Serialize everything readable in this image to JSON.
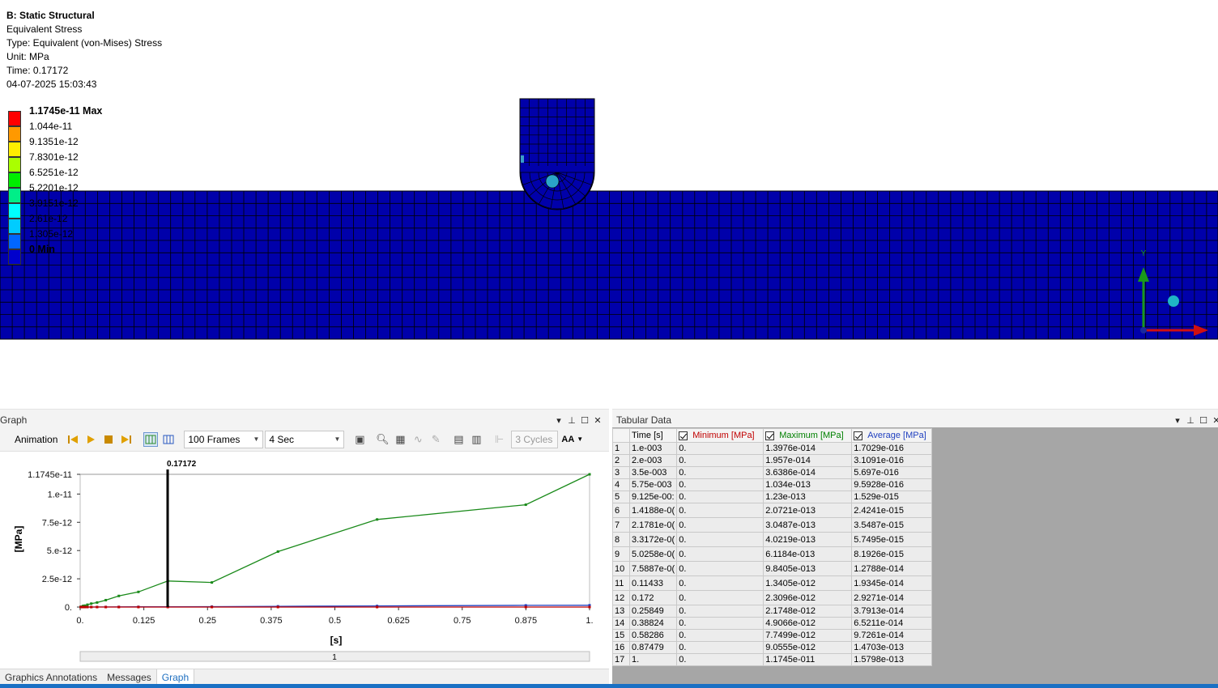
{
  "viewport": {
    "info": {
      "system": "B: Static Structural",
      "result": "Equivalent Stress",
      "type": "Type: Equivalent (von-Mises) Stress",
      "unit": "Unit: MPa",
      "time": "Time: 0.17172",
      "date": "04-07-2025 15:03:43"
    },
    "legend": {
      "max_label": "1.1745e-11 Max",
      "levels": [
        "1.044e-11",
        "9.1351e-12",
        "7.8301e-12",
        "6.5251e-12",
        "5.2201e-12",
        "3.9151e-12",
        "2.61e-12",
        "1.305e-12"
      ],
      "min_label": "0 Min",
      "colors": [
        "#ff0000",
        "#ff9900",
        "#ffee00",
        "#aaff00",
        "#00ee00",
        "#00ee88",
        "#00ffff",
        "#00ccff",
        "#0066ff",
        "#0000cc"
      ]
    },
    "triad": {
      "y_label": "Y"
    },
    "mesh_color": "#0000aa"
  },
  "graph_panel": {
    "title": "Graph",
    "toolbar": {
      "animation_label": "Animation",
      "frames_value": "100 Frames",
      "duration_value": "4 Sec",
      "cycles_placeholder": "3 Cycles",
      "font_button": "AA"
    },
    "tabs": [
      "Graphics Annotations",
      "Messages",
      "Graph"
    ],
    "active_tab": "Graph",
    "timeline_value": "1"
  },
  "tabular_panel": {
    "title": "Tabular Data",
    "columns": [
      "Time [s]",
      "Minimum [MPa]",
      "Maximum [MPa]",
      "Average [MPa]"
    ],
    "column_colors": [
      "#000000",
      "#c00000",
      "#008000",
      "#1f3fbf"
    ],
    "rows": [
      [
        "1",
        "1.e-003",
        "0.",
        "1.3976e-014",
        "1.7029e-016"
      ],
      [
        "2",
        "2.e-003",
        "0.",
        "1.957e-014",
        "3.1091e-016"
      ],
      [
        "3",
        "3.5e-003",
        "0.",
        "3.6386e-014",
        "5.697e-016"
      ],
      [
        "4",
        "5.75e-003",
        "0.",
        "1.034e-013",
        "9.5928e-016"
      ],
      [
        "5",
        "9.125e-00:",
        "0.",
        "1.23e-013",
        "1.529e-015"
      ],
      [
        "6",
        "1.4188e-0(",
        "0.",
        "2.0721e-013",
        "2.4241e-015"
      ],
      [
        "7",
        "2.1781e-0(",
        "0.",
        "3.0487e-013",
        "3.5487e-015"
      ],
      [
        "8",
        "3.3172e-0(",
        "0.",
        "4.0219e-013",
        "5.7495e-015"
      ],
      [
        "9",
        "5.0258e-0(",
        "0.",
        "6.1184e-013",
        "8.1926e-015"
      ],
      [
        "10",
        "7.5887e-0(",
        "0.",
        "9.8405e-013",
        "1.2788e-014"
      ],
      [
        "11",
        "0.11433",
        "0.",
        "1.3405e-012",
        "1.9345e-014"
      ],
      [
        "12",
        "0.172",
        "0.",
        "2.3096e-012",
        "2.9271e-014"
      ],
      [
        "13",
        "0.25849",
        "0.",
        "2.1748e-012",
        "3.7913e-014"
      ],
      [
        "14",
        "0.38824",
        "0.",
        "4.9066e-012",
        "6.5211e-014"
      ],
      [
        "15",
        "0.58286",
        "0.",
        "7.7499e-012",
        "9.7261e-014"
      ],
      [
        "16",
        "0.87479",
        "0.",
        "9.0555e-012",
        "1.4703e-013"
      ],
      [
        "17",
        "1.",
        "0.",
        "1.1745e-011",
        "1.5798e-013"
      ]
    ]
  },
  "chart_data": {
    "type": "line",
    "title": "",
    "xlabel": "[s]",
    "ylabel": "[MPa]",
    "xlim": [
      0,
      1
    ],
    "ylim": [
      0,
      1.1745e-11
    ],
    "x_ticks": [
      "0.",
      "0.125",
      "0.25",
      "0.375",
      "0.5",
      "0.625",
      "0.75",
      "0.875",
      "1."
    ],
    "y_ticks": [
      "0.",
      "2.5e-12",
      "5.e-12",
      "7.5e-12",
      "1.e-11",
      "1.1745e-11"
    ],
    "cursor": {
      "x": 0.17172,
      "label": "0.17172"
    },
    "x": [
      0.001,
      0.002,
      0.0035,
      0.00575,
      0.009125,
      0.014188,
      0.021781,
      0.033172,
      0.050258,
      0.075887,
      0.11433,
      0.172,
      0.25849,
      0.38824,
      0.58286,
      0.87479,
      1.0
    ],
    "series": [
      {
        "name": "Minimum [MPa]",
        "color": "#c00000",
        "values": [
          0,
          0,
          0,
          0,
          0,
          0,
          0,
          0,
          0,
          0,
          0,
          0,
          0,
          0,
          0,
          0,
          0
        ]
      },
      {
        "name": "Maximum [MPa]",
        "color": "#1a8a1a",
        "values": [
          1.3976e-14,
          1.957e-14,
          3.6386e-14,
          1.034e-13,
          1.23e-13,
          2.0721e-13,
          3.0487e-13,
          4.0219e-13,
          6.1184e-13,
          9.8405e-13,
          1.3405e-12,
          2.3096e-12,
          2.1748e-12,
          4.9066e-12,
          7.7499e-12,
          9.0555e-12,
          1.1745e-11
        ]
      },
      {
        "name": "Average [MPa]",
        "color": "#1f3fbf",
        "values": [
          1.7029e-16,
          3.1091e-16,
          5.697e-16,
          9.5928e-16,
          1.529e-15,
          2.4241e-15,
          3.5487e-15,
          5.7495e-15,
          8.1926e-15,
          1.2788e-14,
          1.9345e-14,
          2.9271e-14,
          3.7913e-14,
          6.5211e-14,
          9.7261e-14,
          1.4703e-13,
          1.5798e-13
        ]
      }
    ]
  }
}
